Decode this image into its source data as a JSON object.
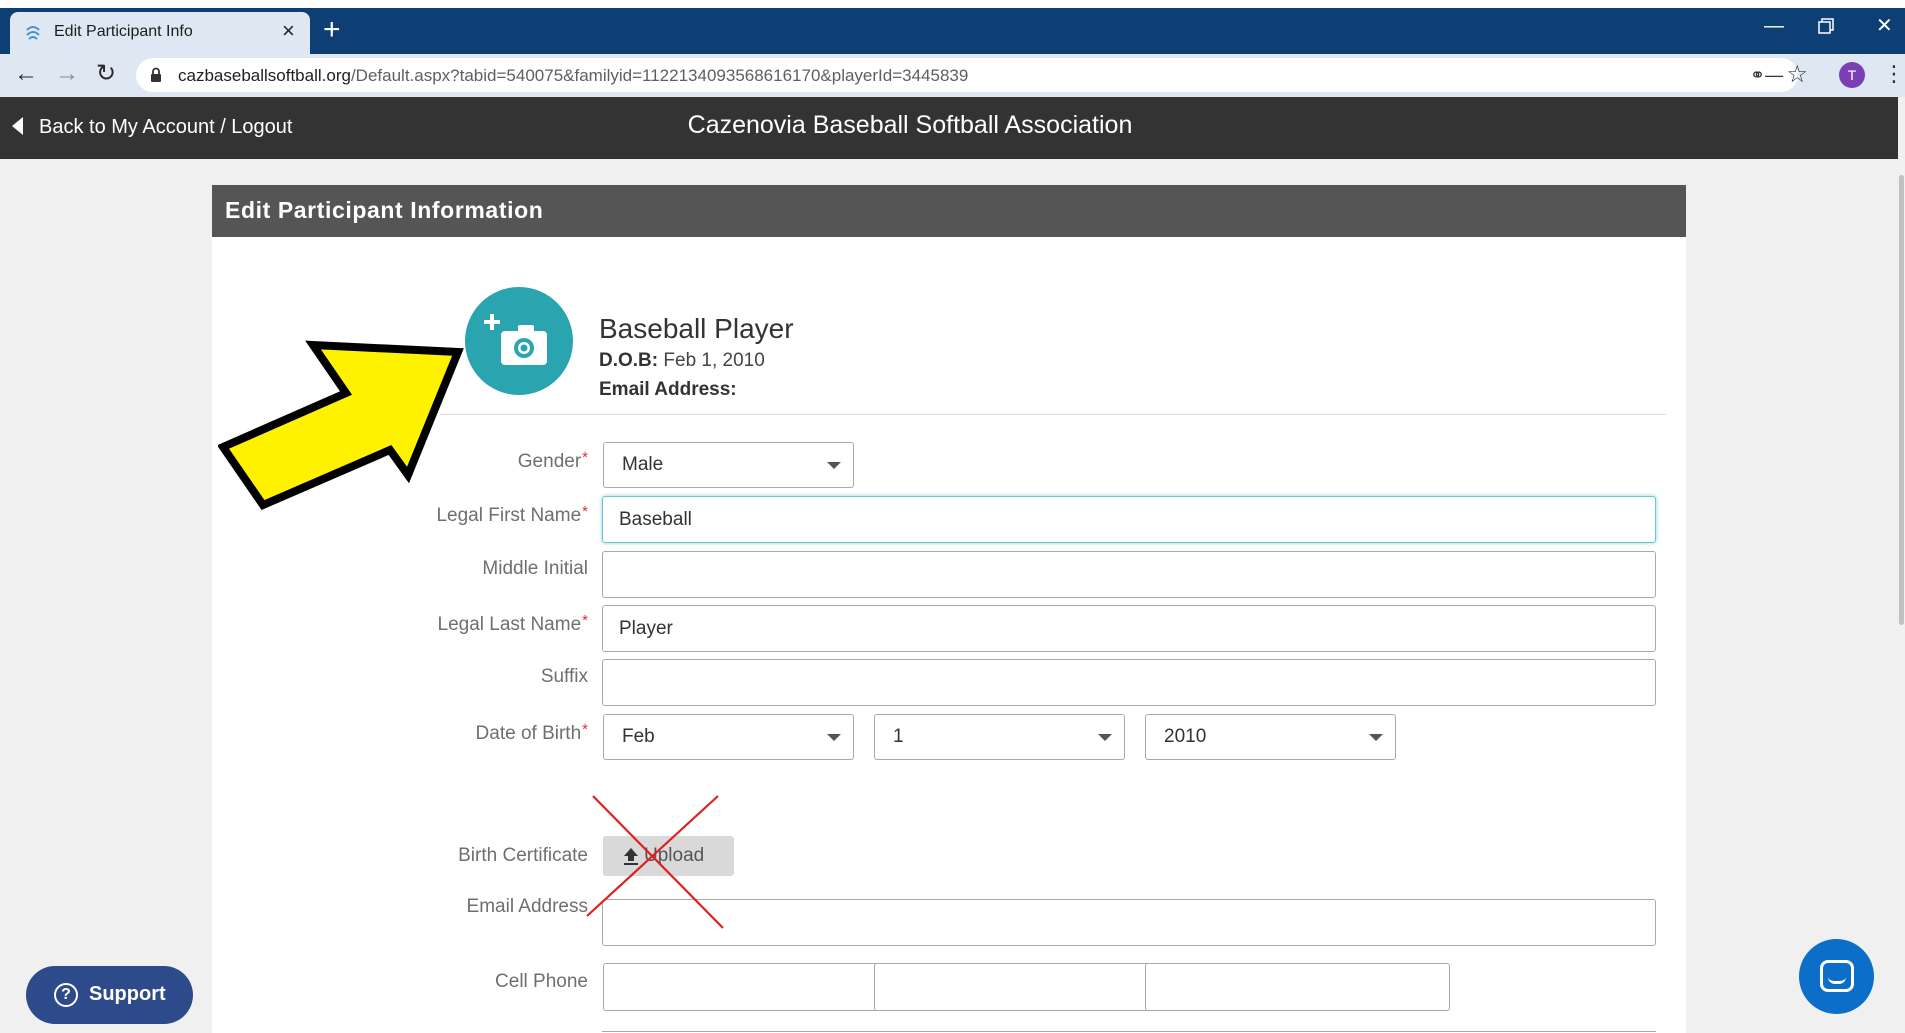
{
  "browser": {
    "tab_title": "Edit Participant Info",
    "url_host": "cazbaseballsoftball.org",
    "url_path": "/Default.aspx?tabid=540075&familyid=1122134093568616170&playerId=3445839",
    "profile_initial": "T"
  },
  "header": {
    "back_link": "Back to My Account / Logout",
    "site_title": "Cazenovia Baseball Softball Association"
  },
  "panel": {
    "title": "Edit Participant Information"
  },
  "participant": {
    "name": "Baseball Player",
    "dob_label": "D.O.B:",
    "dob_value": "Feb 1, 2010",
    "email_label": "Email Address:"
  },
  "form": {
    "required_mark": "*",
    "gender": {
      "label": "Gender",
      "value": "Male"
    },
    "first_name": {
      "label": "Legal First Name",
      "value": "Baseball"
    },
    "middle_initial": {
      "label": "Middle Initial",
      "value": ""
    },
    "last_name": {
      "label": "Legal Last Name",
      "value": "Player"
    },
    "suffix": {
      "label": "Suffix",
      "value": ""
    },
    "dob": {
      "label": "Date of Birth",
      "month": "Feb",
      "day": "1",
      "year": "2010"
    },
    "birth_certificate": {
      "label": "Birth Certificate",
      "button": "Upload"
    },
    "email": {
      "label": "Email Address",
      "value": ""
    },
    "cell_phone": {
      "label": "Cell Phone"
    }
  },
  "widgets": {
    "support_label": "Support",
    "support_icon": "?"
  },
  "icons": {
    "tab_favicon": "swirl-icon",
    "photo": "camera-add-icon",
    "upload": "upload-arrow-icon",
    "chat": "chat-bubble-icon"
  },
  "colors": {
    "browser_tabbar": "#0d3f75",
    "site_header": "#333333",
    "panel_header": "#555555",
    "photo_accent": "#2aa4ae",
    "required": "#d9303a",
    "focus": "#67c6d1",
    "support_button": "#2d4a8a",
    "chat_button": "#0b6ec9",
    "annotation_arrow": "#fff200",
    "annotation_x": "#e02020"
  }
}
